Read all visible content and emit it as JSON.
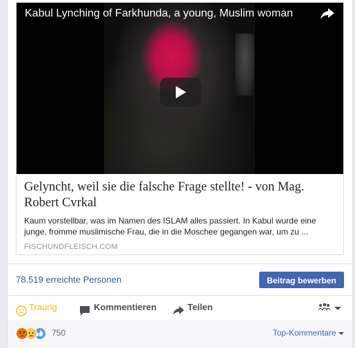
{
  "video": {
    "title": "Kabul Lynching of Farkhunda, a young, Muslim woman"
  },
  "link": {
    "title": "Gelyncht, weil sie die falsche Frage stellte! - von Mag. Robert Cvrkal",
    "description": "Kaum vorstellbar, was im Namen des ISLAM alles passiert. In Kabul wurde eine junge, fromme muslimische Frau, die in die Moschee gegangen war, um zu ...",
    "domain": "FISCHUNDFLEISCH.COM"
  },
  "stats": {
    "reach": "78.519 erreichte Personen",
    "boost_label": "Beitrag bewerben"
  },
  "actions": {
    "reaction_label": "Traurig",
    "comment_label": "Kommentieren",
    "share_label": "Teilen"
  },
  "footer": {
    "reaction_count": "750",
    "sort_label": "Top-Kommentare"
  },
  "colors": {
    "link_blue": "#365899",
    "button_blue": "#4267b2",
    "sad_yellow": "#f0ba15",
    "angry_red": "#e9710f",
    "like_blue": "#5890ff"
  },
  "icons": [
    "share-arrow-icon",
    "play-icon",
    "sad-face-icon",
    "comment-bubble-icon",
    "share-icon",
    "audience-icon",
    "chevron-down-icon",
    "angry-reaction-icon",
    "sad-reaction-icon",
    "like-reaction-icon"
  ]
}
